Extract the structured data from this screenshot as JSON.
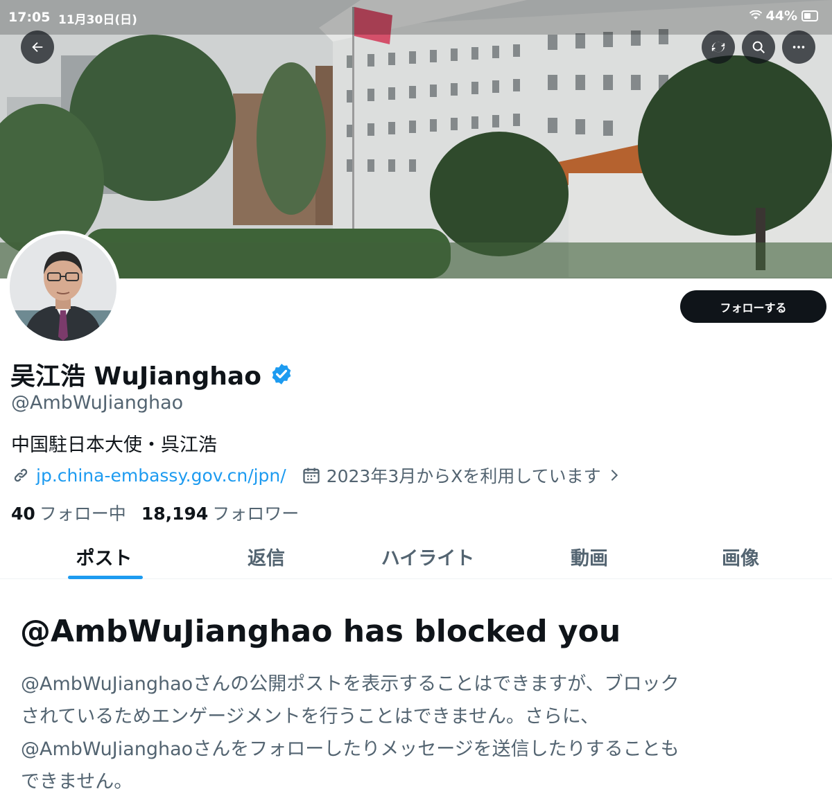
{
  "status_bar": {
    "time": "17:05",
    "date": "11月30日(日)",
    "battery_percent": "44%"
  },
  "header": {
    "back_icon": "arrow-left-icon",
    "actions": [
      "refresh-icon",
      "search-icon",
      "more-icon"
    ]
  },
  "profile": {
    "display_name": "吴江浩 WuJianghao",
    "verified": true,
    "handle": "@AmbWuJianghao",
    "bio": "中国駐日本大使・呉江浩",
    "website": "jp.china-embassy.gov.cn/jpn/",
    "joined": "2023年3月からXを利用しています",
    "following_count": "40",
    "following_label": "フォロー中",
    "followers_count": "18,194",
    "followers_label": "フォロワー",
    "follow_button_label": "フォローする"
  },
  "tabs": [
    {
      "label": "ポスト",
      "active": true
    },
    {
      "label": "返信",
      "active": false
    },
    {
      "label": "ハイライト",
      "active": false
    },
    {
      "label": "動画",
      "active": false
    },
    {
      "label": "画像",
      "active": false
    }
  ],
  "blocked": {
    "title": "@AmbWuJianghao has blocked you",
    "line1": "@AmbWuJianghaoさんの公開ポストを表示することはできますが、ブロック",
    "line2": "されているためエンゲージメントを行うことはできません。さらに、",
    "line3": "@AmbWuJianghaoさんをフォローしたりメッセージを送信したりすることも",
    "line4": "できません。"
  },
  "colors": {
    "accent": "#1d9bf0",
    "text_primary": "#0f1419",
    "text_secondary": "#536471"
  }
}
